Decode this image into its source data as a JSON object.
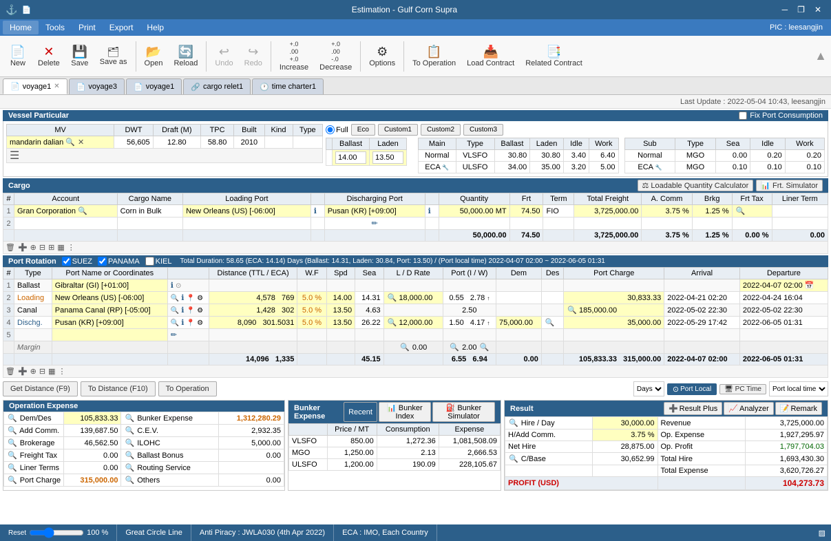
{
  "titlebar": {
    "title": "Estimation - Gulf Corn Supra",
    "icons": [
      "minimize",
      "restore",
      "close"
    ]
  },
  "menubar": {
    "items": [
      "Home",
      "Tools",
      "Print",
      "Export",
      "Help"
    ],
    "active": "Home",
    "pic": "PIC : leesangjin"
  },
  "toolbar": {
    "buttons": [
      "New",
      "Delete",
      "Save",
      "Save as",
      "Open",
      "Reload",
      "Undo",
      "Redo",
      "Increase",
      "Decrease",
      "Options",
      "To Operation",
      "Load Contract",
      "Related Contract"
    ]
  },
  "tabs": [
    {
      "label": "voyage1",
      "active": true,
      "closable": true
    },
    {
      "label": "voyage3",
      "active": false,
      "closable": false
    },
    {
      "label": "voyage1",
      "active": false,
      "closable": false
    },
    {
      "label": "cargo relet1",
      "active": false,
      "closable": false
    },
    {
      "label": "time charter1",
      "active": false,
      "closable": false
    }
  ],
  "update_bar": "Last Update : 2022-05-04 10:43, leesangjin",
  "vessel_particular": {
    "title": "Vessel Particular",
    "fix_port": "Fix Port Consumption",
    "columns": [
      "MV",
      "DWT",
      "Draft (M)",
      "TPC",
      "Built",
      "Kind",
      "Type"
    ],
    "row": {
      "mv": "mandarin dalian",
      "dwt": "56,605",
      "draft": "12.80",
      "tpc": "58.80",
      "built": "2010",
      "kind": "",
      "type": ""
    },
    "fuel_tabs": [
      "Full",
      "Eco",
      "Custom1",
      "Custom2",
      "Custom3"
    ],
    "ballast_value": "14.00",
    "laden_value": "13.50",
    "main_fuel": {
      "headers": [
        "Main",
        "Type",
        "Ballast",
        "Laden",
        "Idle",
        "Work"
      ],
      "rows": [
        {
          "main": "Normal",
          "type": "VLSFO",
          "ballast": "30.80",
          "laden": "30.80",
          "idle": "3.40",
          "work": "6.40"
        },
        {
          "main": "ECA",
          "type": "ULSFO",
          "ballast": "34.00",
          "laden": "35.00",
          "idle": "3.20",
          "work": "5.00"
        }
      ]
    },
    "sub_fuel": {
      "headers": [
        "Sub",
        "Type",
        "Sea",
        "Idle",
        "Work"
      ],
      "rows": [
        {
          "sub": "Normal",
          "type": "MGO",
          "sea": "0.00",
          "idle": "0.20",
          "work": "0.20"
        },
        {
          "sub": "ECA",
          "type": "MGO",
          "sea": "0.10",
          "idle": "0.10",
          "work": "0.10"
        }
      ]
    }
  },
  "cargo": {
    "title": "Cargo",
    "loadable_qty_btn": "Loadable Quantity Calculator",
    "frt_simulator_btn": "Frt. Simulator",
    "columns": [
      "",
      "Account",
      "Cargo Name",
      "Loading Port",
      "",
      "Discharging Port",
      "",
      "Quantity",
      "Frt",
      "Term",
      "Total Freight",
      "A. Comm",
      "Brkg",
      "Frt Tax",
      "Liner Term"
    ],
    "rows": [
      {
        "num": "1",
        "account": "Gran Corporation",
        "cargo_name": "Corn in Bulk",
        "loading_port": "New Orleans (US) [-06:00]",
        "discharging_port": "Pusan (KR) [+09:00]",
        "quantity": "50,000.00",
        "unit": "MT",
        "frt": "74.50",
        "term": "FIO",
        "total_freight": "3,725,000.00",
        "a_comm": "3.75 %",
        "brkg": "1.25 %",
        "frt_tax": "",
        "liner_term": ""
      },
      {
        "num": "2",
        "account": "",
        "cargo_name": "",
        "loading_port": "",
        "discharging_port": "",
        "quantity": "",
        "frt": "",
        "term": "",
        "total_freight": "",
        "a_comm": "",
        "brkg": "",
        "frt_tax": "",
        "liner_term": ""
      }
    ],
    "totals": {
      "quantity": "50,000.00",
      "frt": "74.50",
      "total_freight": "3,725,000.00",
      "a_comm": "3.75 %",
      "brkg": "1.25 %",
      "frt_tax": "0.00 %",
      "liner_term": "0.00"
    }
  },
  "port_rotation": {
    "title": "Port Rotation",
    "checkboxes": [
      {
        "label": "SUEZ",
        "checked": true
      },
      {
        "label": "PANAMA",
        "checked": true
      },
      {
        "label": "KIEL",
        "checked": false
      }
    ],
    "duration": "Total Duration: 58.65 (ECA: 14.14) Days (Ballast: 14.31, Laden: 30.84, Port: 13.50) / (Port local time) 2022-04-07 02:00 ~ 2022-06-05 01:31",
    "columns": [
      "",
      "Type",
      "Port Name or Coordinates",
      "",
      "Distance (TTL / ECA)",
      "W.F",
      "Spd",
      "Sea",
      "L / D Rate",
      "Port (I / W)",
      "Dem",
      "Des",
      "Port Charge",
      "Arrival",
      "Departure"
    ],
    "rows": [
      {
        "num": "1",
        "type": "Ballast",
        "port": "Gibraltar (GI) [+01:00]",
        "dist_ttl": "",
        "dist_eca": "",
        "wf": "",
        "spd": "",
        "sea": "",
        "ld_rate": "",
        "port_i": "",
        "port_w": "",
        "dem": "",
        "des": "",
        "port_charge": "",
        "arrival": "",
        "departure": "2022-04-07 02:00"
      },
      {
        "num": "2",
        "type": "Loading",
        "port": "New Orleans (US) [-06:00]",
        "dist_ttl": "4,578",
        "dist_eca": "769",
        "wf": "5.0 %",
        "spd": "14.00",
        "sea": "14.31",
        "ld_rate": "18,000.00",
        "port_i": "0.55",
        "port_w": "2.78",
        "dem": "",
        "des": "",
        "port_charge": "30,833.33",
        "arrival": "2022-04-21 02:20",
        "departure": "2022-04-24 16:04"
      },
      {
        "num": "3",
        "type": "Canal",
        "port": "Panama Canal (RP) [-05:00]",
        "dist_ttl": "1,428",
        "dist_eca": "302",
        "wf": "5.0 %",
        "spd": "13.50",
        "sea": "4.63",
        "ld_rate": "",
        "port_i": "",
        "port_w": "2.50",
        "dem": "",
        "des": "",
        "port_charge": "185,000.00",
        "arrival": "2022-05-02 22:30",
        "departure": "2022-05-02 22:30"
      },
      {
        "num": "4",
        "type": "Dischg.",
        "port": "Pusan (KR) [+09:00]",
        "dist_ttl": "8,090",
        "dist_eca": "301.5031",
        "wf": "5.0 %",
        "spd": "13.50",
        "sea": "26.22",
        "ld_rate": "12,000.00",
        "port_i": "1.50",
        "port_w": "4.17",
        "dem": "75,000.00",
        "des": "",
        "port_charge": "35,000.00",
        "arrival": "2022-05-29 17:42",
        "departure": "2022-06-05 01:31"
      },
      {
        "num": "5",
        "type": "",
        "port": "",
        "dist_ttl": "",
        "dist_eca": "",
        "wf": "",
        "spd": "",
        "sea": "",
        "ld_rate": "",
        "port_i": "",
        "port_w": "",
        "dem": "",
        "des": "",
        "port_charge": "",
        "arrival": "",
        "departure": ""
      }
    ],
    "margin_row": {
      "ld_rate": "0.00",
      "port_w": "2.00"
    },
    "totals": {
      "dist_ttl": "14,096",
      "dist_eca": "1,335",
      "sea": "45.15",
      "port_i": "6.55",
      "port_w": "6.94",
      "dem": "0.00",
      "port_charge": "105,833.33",
      "total2": "315,000.00",
      "arrival": "2022-04-07 02:00",
      "departure": "2022-06-05 01:31"
    }
  },
  "navigation_buttons": {
    "get_distance": "Get Distance (F9)",
    "to_distance": "To Distance (F10)",
    "to_operation": "To Operation"
  },
  "operation_expense": {
    "title": "Operation Expense",
    "rows": [
      {
        "label": "Dem/Des",
        "value": "105,833.33",
        "label2": "Bunker Expense",
        "value2": "1,312,280.29"
      },
      {
        "label": "Add Comm.",
        "value": "139,687.50",
        "label2": "C.E.V.",
        "value2": "2,932.35"
      },
      {
        "label": "Brokerage",
        "value": "46,562.50",
        "label2": "ILOHC",
        "value2": "5,000.00"
      },
      {
        "label": "Freight Tax",
        "value": "0.00",
        "label2": "Ballast Bonus",
        "value2": "0.00"
      },
      {
        "label": "Liner Terms",
        "value": "0.00",
        "label2": "Routing Service",
        "value2": ""
      },
      {
        "label": "Port Charge",
        "value": "315,000.00",
        "label2": "Others",
        "value2": "0.00"
      }
    ]
  },
  "bunker_expense": {
    "title": "Bunker Expense",
    "tabs": [
      "Recent",
      "Bunker Index",
      "Bunker Simulator"
    ],
    "columns": [
      "",
      "Price / MT",
      "Consumption",
      "Expense"
    ],
    "rows": [
      {
        "fuel": "VLSFO",
        "price": "850.00",
        "consumption": "1,272.36",
        "expense": "1,081,508.09"
      },
      {
        "fuel": "MGO",
        "price": "1,250.00",
        "consumption": "2.13",
        "expense": "2,666.53"
      },
      {
        "fuel": "ULSFO",
        "price": "1,200.00",
        "consumption": "190.09",
        "expense": "228,105.67"
      }
    ]
  },
  "result": {
    "title": "Result",
    "buttons": [
      "Result Plus",
      "Analyzer",
      "Remark"
    ],
    "rows": [
      {
        "label": "Hire / Day",
        "value": "30,000.00",
        "label2": "Revenue",
        "value2": "3,725,000.00"
      },
      {
        "label": "H/Add Comm.",
        "value": "3.75 %",
        "label2": "Op. Expense",
        "value2": "1,927,295.97"
      },
      {
        "label": "Net Hire",
        "value": "28,875.00",
        "label2": "Op. Profit",
        "value2": "1,797,704.03"
      },
      {
        "label": "C/Base",
        "value": "30,652.99",
        "label2": "Total Hire",
        "value2": "1,693,430.30"
      },
      {
        "label": "",
        "value": "",
        "label2": "Total Expense",
        "value2": "3,620,726.27"
      },
      {
        "label": "PROFIT (USD)",
        "value": "",
        "label2": "",
        "value2": "104,273.73"
      }
    ]
  },
  "status_bar": {
    "zoom": "100 %",
    "text1": "Great Circle Line",
    "text2": "Anti Piracy : JWLA030 (4th Apr 2022)",
    "text3": "ECA : IMO, Each Country"
  }
}
